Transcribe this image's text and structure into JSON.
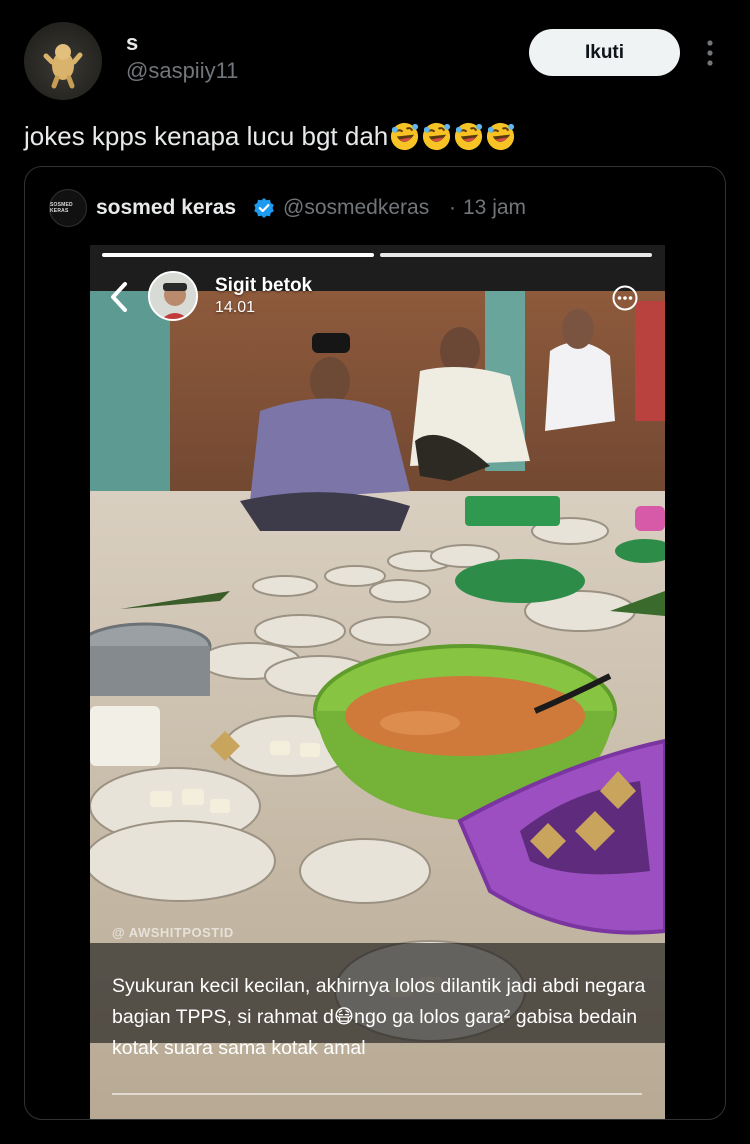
{
  "tweet": {
    "author_name": "s",
    "author_handle": "@saspiiy11",
    "follow_label": "Ikuti",
    "text": "jokes kpps kenapa lucu bgt dah",
    "emoji_count": 4,
    "emoji": "rolling-on-floor-laughing-icon"
  },
  "quote": {
    "avatar_text": "SOSMED KERAS",
    "name": "sosmed keras",
    "handle": "@sosmedkeras",
    "separator": "·",
    "time": "13 jam",
    "verified": true,
    "accent_color": "#1d9bf0"
  },
  "story": {
    "user": "Sigit betok",
    "time": "14.01",
    "watermark": "@ AWSHITPOSTID",
    "caption": "Syukuran kecil kecilan, akhirnya lolos dilantik jadi abdi negara bagian TPPS, si rahmat d😷ngo ga lolos gara² gabisa bedain kotak suara sama kotak amal"
  },
  "colors": {
    "background": "#000000",
    "text": "#e7e9ea",
    "muted": "#71767b",
    "follow_bg": "#eff3f4"
  }
}
